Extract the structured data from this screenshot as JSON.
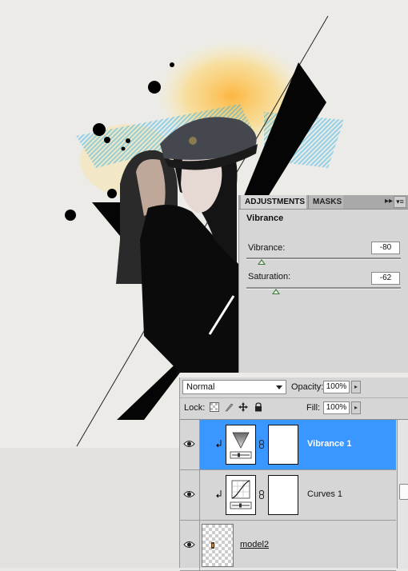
{
  "adjustments_panel": {
    "tabs": [
      "ADJUSTMENTS",
      "MASKS"
    ],
    "collapse_glyph": "▸▸",
    "menu_glyph": "▾≡",
    "title": "Vibrance",
    "vibrance": {
      "label": "Vibrance:",
      "value": "-80",
      "slider_fraction": 0.1
    },
    "saturation": {
      "label": "Saturation:",
      "value": "-62",
      "slider_fraction": 0.19
    }
  },
  "layers_panel": {
    "blend_mode": "Normal",
    "opacity_label": "Opacity:",
    "opacity_value": "100%",
    "lock_label": "Lock:",
    "fill_label": "Fill:",
    "fill_value": "100%",
    "stepper_glyph": "▸",
    "layers": [
      {
        "name": "Vibrance 1",
        "selected": true,
        "icon": "vibrance-adjustment-icon"
      },
      {
        "name": "Curves 1",
        "selected": false,
        "icon": "curves-adjustment-icon"
      },
      {
        "name": "model2",
        "selected": false,
        "icon": "layer-thumbnail"
      }
    ]
  },
  "colors": {
    "selection": "#3a97ff",
    "panel": "#d6d6d6",
    "slider_thumb": "#3a7a36"
  }
}
